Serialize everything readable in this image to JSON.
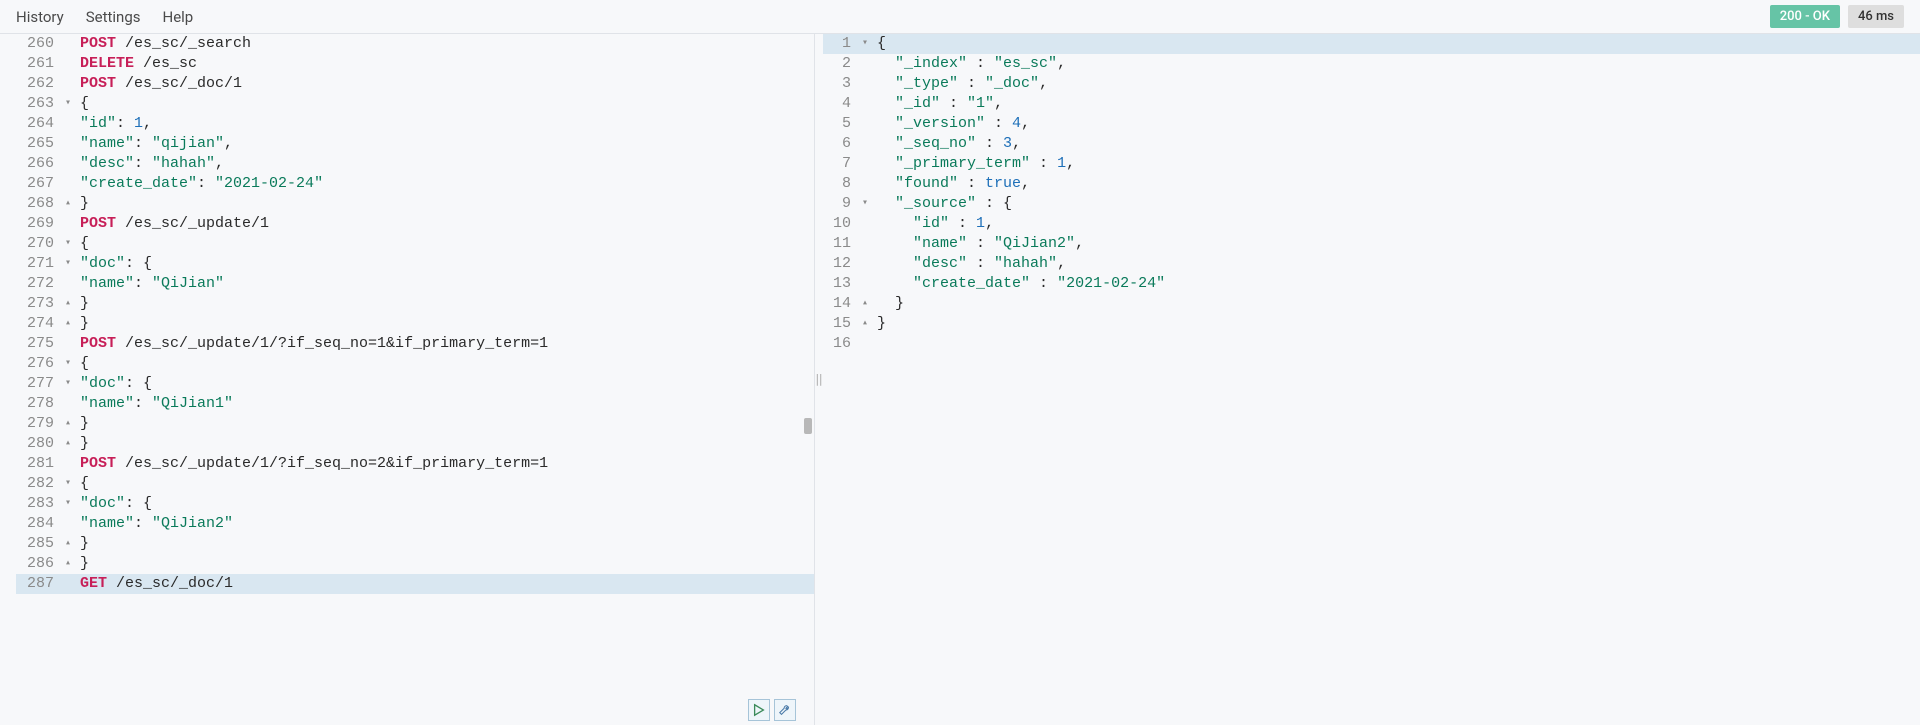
{
  "menu": {
    "history": "History",
    "settings": "Settings",
    "help": "Help"
  },
  "status": {
    "code": "200 - OK",
    "time": "46 ms"
  },
  "request": {
    "lines": [
      {
        "n": 260,
        "fold": "",
        "tokens": [
          [
            "method-post",
            "POST"
          ],
          [
            "path",
            " /es_sc/_search"
          ]
        ]
      },
      {
        "n": 261,
        "fold": "",
        "tokens": [
          [
            "method-delete",
            "DELETE"
          ],
          [
            "path",
            " /es_sc"
          ]
        ]
      },
      {
        "n": 262,
        "fold": "",
        "tokens": [
          [
            "method-post",
            "POST"
          ],
          [
            "path",
            " /es_sc/_doc/1"
          ]
        ]
      },
      {
        "n": 263,
        "fold": "▾",
        "tokens": [
          [
            "punc",
            "{"
          ]
        ]
      },
      {
        "n": 264,
        "fold": "",
        "tokens": [
          [
            "key",
            "\"id\""
          ],
          [
            "punc",
            ": "
          ],
          [
            "number",
            "1"
          ],
          [
            "punc",
            ","
          ]
        ]
      },
      {
        "n": 265,
        "fold": "",
        "tokens": [
          [
            "key",
            "\"name\""
          ],
          [
            "punc",
            ": "
          ],
          [
            "string",
            "\"qijian\""
          ],
          [
            "punc",
            ","
          ]
        ]
      },
      {
        "n": 266,
        "fold": "",
        "tokens": [
          [
            "key",
            "\"desc\""
          ],
          [
            "punc",
            ": "
          ],
          [
            "string",
            "\"hahah\""
          ],
          [
            "punc",
            ","
          ]
        ]
      },
      {
        "n": 267,
        "fold": "",
        "tokens": [
          [
            "key",
            "\"create_date\""
          ],
          [
            "punc",
            ": "
          ],
          [
            "string",
            "\"2021-02-24\""
          ]
        ]
      },
      {
        "n": 268,
        "fold": "▴",
        "tokens": [
          [
            "punc",
            "}"
          ]
        ]
      },
      {
        "n": 269,
        "fold": "",
        "tokens": [
          [
            "method-post",
            "POST"
          ],
          [
            "path",
            " /es_sc/_update/1"
          ]
        ]
      },
      {
        "n": 270,
        "fold": "▾",
        "tokens": [
          [
            "punc",
            "{"
          ]
        ]
      },
      {
        "n": 271,
        "fold": "▾",
        "tokens": [
          [
            "key",
            "\"doc\""
          ],
          [
            "punc",
            ": {"
          ]
        ]
      },
      {
        "n": 272,
        "fold": "",
        "tokens": [
          [
            "key",
            "\"name\""
          ],
          [
            "punc",
            ": "
          ],
          [
            "string",
            "\"QiJian\""
          ]
        ]
      },
      {
        "n": 273,
        "fold": "▴",
        "tokens": [
          [
            "punc",
            "}"
          ]
        ]
      },
      {
        "n": 274,
        "fold": "▴",
        "tokens": [
          [
            "punc",
            "}"
          ]
        ]
      },
      {
        "n": 275,
        "fold": "",
        "tokens": [
          [
            "method-post",
            "POST"
          ],
          [
            "path",
            " /es_sc/_update/1/?if_seq_no=1&if_primary_term=1"
          ]
        ]
      },
      {
        "n": 276,
        "fold": "▾",
        "tokens": [
          [
            "punc",
            "{"
          ]
        ]
      },
      {
        "n": 277,
        "fold": "▾",
        "tokens": [
          [
            "key",
            "\"doc\""
          ],
          [
            "punc",
            ": {"
          ]
        ]
      },
      {
        "n": 278,
        "fold": "",
        "tokens": [
          [
            "key",
            "\"name\""
          ],
          [
            "punc",
            ": "
          ],
          [
            "string",
            "\"QiJian1\""
          ]
        ]
      },
      {
        "n": 279,
        "fold": "▴",
        "tokens": [
          [
            "punc",
            "}"
          ]
        ]
      },
      {
        "n": 280,
        "fold": "▴",
        "tokens": [
          [
            "punc",
            "}"
          ]
        ]
      },
      {
        "n": 281,
        "fold": "",
        "tokens": [
          [
            "method-post",
            "POST"
          ],
          [
            "path",
            " /es_sc/_update/1/?if_seq_no=2&if_primary_term=1"
          ]
        ]
      },
      {
        "n": 282,
        "fold": "▾",
        "tokens": [
          [
            "punc",
            "{"
          ]
        ]
      },
      {
        "n": 283,
        "fold": "▾",
        "tokens": [
          [
            "key",
            "\"doc\""
          ],
          [
            "punc",
            ": {"
          ]
        ]
      },
      {
        "n": 284,
        "fold": "",
        "tokens": [
          [
            "key",
            "\"name\""
          ],
          [
            "punc",
            ": "
          ],
          [
            "string",
            "\"QiJian2\""
          ]
        ]
      },
      {
        "n": 285,
        "fold": "▴",
        "tokens": [
          [
            "punc",
            "}"
          ]
        ]
      },
      {
        "n": 286,
        "fold": "▴",
        "tokens": [
          [
            "punc",
            "}"
          ]
        ]
      },
      {
        "n": 287,
        "fold": "",
        "current": true,
        "tokens": [
          [
            "method-get",
            "GET"
          ],
          [
            "path",
            " /es_sc/_doc/1"
          ]
        ]
      }
    ]
  },
  "response": {
    "lines": [
      {
        "n": 1,
        "fold": "▾",
        "current": true,
        "tokens": [
          [
            "punc",
            "{"
          ]
        ]
      },
      {
        "n": 2,
        "fold": "",
        "tokens": [
          [
            "punc",
            "  "
          ],
          [
            "key",
            "\"_index\""
          ],
          [
            "punc",
            " : "
          ],
          [
            "string",
            "\"es_sc\""
          ],
          [
            "punc",
            ","
          ]
        ]
      },
      {
        "n": 3,
        "fold": "",
        "tokens": [
          [
            "punc",
            "  "
          ],
          [
            "key",
            "\"_type\""
          ],
          [
            "punc",
            " : "
          ],
          [
            "string",
            "\"_doc\""
          ],
          [
            "punc",
            ","
          ]
        ]
      },
      {
        "n": 4,
        "fold": "",
        "tokens": [
          [
            "punc",
            "  "
          ],
          [
            "key",
            "\"_id\""
          ],
          [
            "punc",
            " : "
          ],
          [
            "string",
            "\"1\""
          ],
          [
            "punc",
            ","
          ]
        ]
      },
      {
        "n": 5,
        "fold": "",
        "tokens": [
          [
            "punc",
            "  "
          ],
          [
            "key",
            "\"_version\""
          ],
          [
            "punc",
            " : "
          ],
          [
            "number",
            "4"
          ],
          [
            "punc",
            ","
          ]
        ]
      },
      {
        "n": 6,
        "fold": "",
        "tokens": [
          [
            "punc",
            "  "
          ],
          [
            "key",
            "\"_seq_no\""
          ],
          [
            "punc",
            " : "
          ],
          [
            "number",
            "3"
          ],
          [
            "punc",
            ","
          ]
        ]
      },
      {
        "n": 7,
        "fold": "",
        "tokens": [
          [
            "punc",
            "  "
          ],
          [
            "key",
            "\"_primary_term\""
          ],
          [
            "punc",
            " : "
          ],
          [
            "number",
            "1"
          ],
          [
            "punc",
            ","
          ]
        ]
      },
      {
        "n": 8,
        "fold": "",
        "tokens": [
          [
            "punc",
            "  "
          ],
          [
            "key",
            "\"found\""
          ],
          [
            "punc",
            " : "
          ],
          [
            "bool",
            "true"
          ],
          [
            "punc",
            ","
          ]
        ]
      },
      {
        "n": 9,
        "fold": "▾",
        "tokens": [
          [
            "punc",
            "  "
          ],
          [
            "key",
            "\"_source\""
          ],
          [
            "punc",
            " : {"
          ]
        ]
      },
      {
        "n": 10,
        "fold": "",
        "tokens": [
          [
            "punc",
            "    "
          ],
          [
            "key",
            "\"id\""
          ],
          [
            "punc",
            " : "
          ],
          [
            "number",
            "1"
          ],
          [
            "punc",
            ","
          ]
        ]
      },
      {
        "n": 11,
        "fold": "",
        "tokens": [
          [
            "punc",
            "    "
          ],
          [
            "key",
            "\"name\""
          ],
          [
            "punc",
            " : "
          ],
          [
            "string",
            "\"QiJian2\""
          ],
          [
            "punc",
            ","
          ]
        ]
      },
      {
        "n": 12,
        "fold": "",
        "tokens": [
          [
            "punc",
            "    "
          ],
          [
            "key",
            "\"desc\""
          ],
          [
            "punc",
            " : "
          ],
          [
            "string",
            "\"hahah\""
          ],
          [
            "punc",
            ","
          ]
        ]
      },
      {
        "n": 13,
        "fold": "",
        "tokens": [
          [
            "punc",
            "    "
          ],
          [
            "key",
            "\"create_date\""
          ],
          [
            "punc",
            " : "
          ],
          [
            "string",
            "\"2021-02-24\""
          ]
        ]
      },
      {
        "n": 14,
        "fold": "▴",
        "tokens": [
          [
            "punc",
            "  }"
          ]
        ]
      },
      {
        "n": 15,
        "fold": "▴",
        "tokens": [
          [
            "punc",
            "}"
          ]
        ]
      },
      {
        "n": 16,
        "fold": "",
        "tokens": []
      }
    ]
  }
}
